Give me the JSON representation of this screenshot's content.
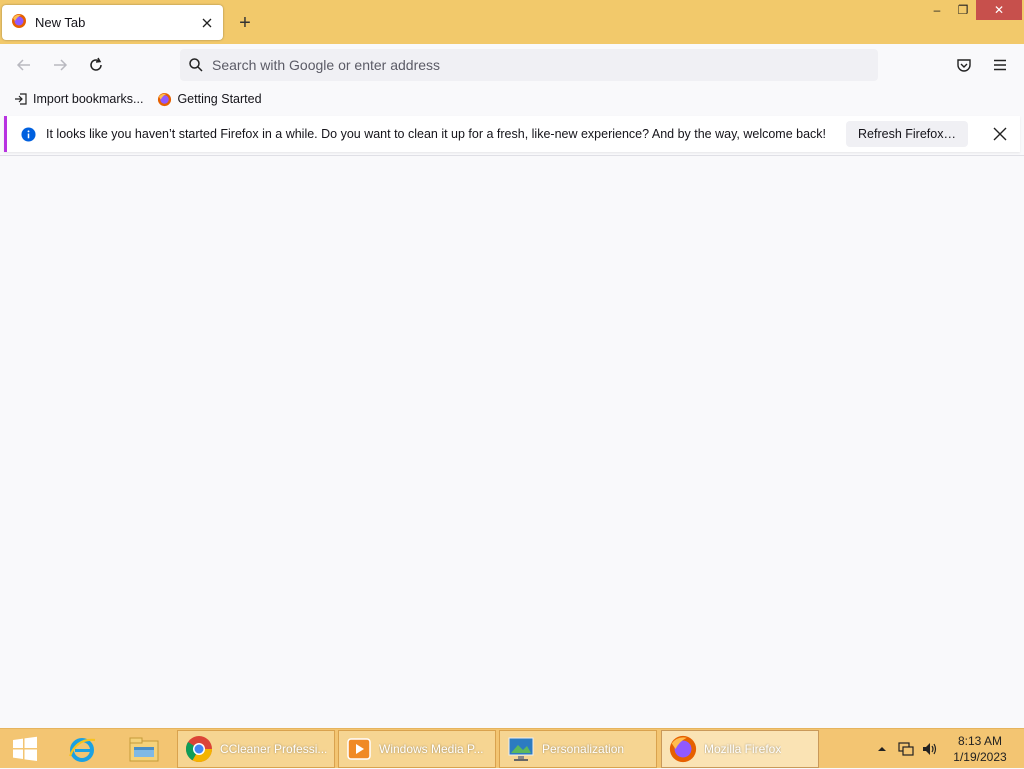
{
  "tab": {
    "title": "New Tab",
    "close_icon": "close-icon"
  },
  "window": {
    "minimize": "–",
    "maximize": "❐",
    "close": "✕"
  },
  "newtab": {
    "label": "+"
  },
  "urlbar": {
    "placeholder": "Search with Google or enter address"
  },
  "bookmarks": [
    {
      "label": "Import bookmarks...",
      "icon": "import-icon"
    },
    {
      "label": "Getting Started",
      "icon": "firefox-icon"
    }
  ],
  "notification": {
    "message": "It looks like you haven’t started Firefox in a while. Do you want to clean it up for a fresh, like-new experience? And by the way, welcome back!",
    "button": "Refresh Firefox…",
    "accent": "#b833e1"
  },
  "taskbar": {
    "tasks": [
      {
        "label": "CCleaner Professi...",
        "icon": "chrome-icon"
      },
      {
        "label": "Windows Media P...",
        "icon": "media-player-icon"
      },
      {
        "label": "Personalization",
        "icon": "personalization-icon"
      },
      {
        "label": "Mozilla Firefox",
        "icon": "firefox-icon"
      }
    ],
    "clock": {
      "time": "8:13 AM",
      "date": "1/19/2023"
    }
  },
  "colors": {
    "titlebar": "#f2c96b",
    "taskbar": "#f3c572",
    "close": "#c7504c"
  }
}
